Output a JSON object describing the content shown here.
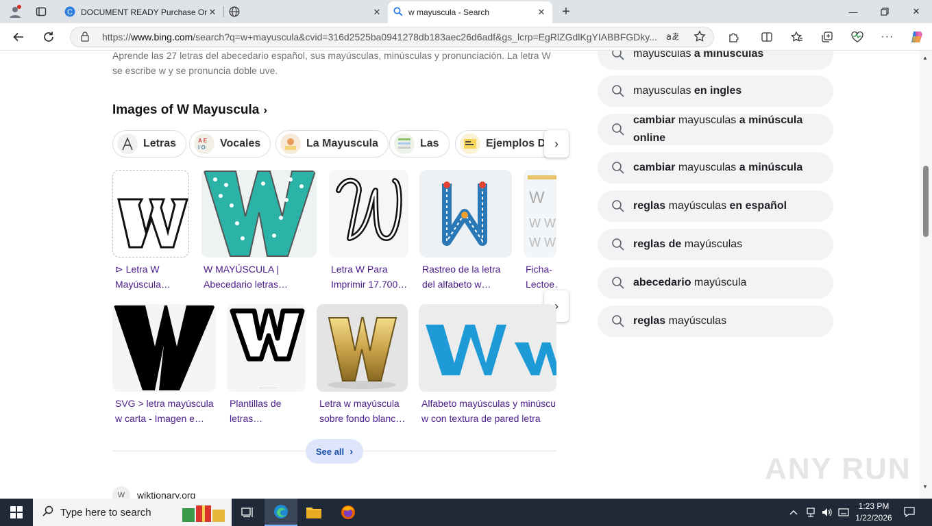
{
  "browser": {
    "tabs": [
      {
        "title": "DOCUMENT READY Purchase Order",
        "active": false
      },
      {
        "title": "",
        "active": false
      },
      {
        "title": "w mayuscula - Search",
        "active": true
      }
    ],
    "new_tab_symbol": "+",
    "url_prefix": "https://",
    "url_host": "www.bing.com",
    "url_rest": "/search?q=w+mayuscula&cvid=316d2525ba0941278db183aec26d6adf&gs_lcrp=EgRlZGdlKgYIABBFGDky..."
  },
  "page": {
    "snippet": "Aprende las 27 letras del abecedario español, sus mayúsculas, minúsculas y pronunciación. La letra W se escribe w y se pronuncia doble uve.",
    "images_heading": "Images of W Mayuscula",
    "chips": [
      "Letras",
      "Vocales",
      "La Mayuscula",
      "Las",
      "Ejemplos De"
    ],
    "row1_captions": [
      "⊳ Letra W Mayúscula…",
      "W MAYÚSCULA | Abecedario letras…",
      "Letra W Para Imprimir 17.700…",
      "Rastreo de la letra del alfabeto w…",
      "Ficha-Lectoe…"
    ],
    "row2_captions": [
      "SVG > letra mayúscula w carta - Imagen e…",
      "Plantillas de letras…",
      "Letra w mayúscula sobre fondo blanc…",
      "Alfabeto mayúsculas y minúscu w con textura de pared letra azu"
    ],
    "see_all": "See all",
    "next_result_site": "wiktionary.org"
  },
  "related_searches": [
    {
      "plain1": "mayusculas ",
      "bold": "a minusculas",
      "plain2": ""
    },
    {
      "plain1": "mayusculas ",
      "bold": "en ingles",
      "plain2": ""
    },
    {
      "bold_pre": "cambiar",
      "plain1": " mayusculas ",
      "bold": "a minúscula online",
      "plain2": ""
    },
    {
      "bold_pre": "cambiar",
      "plain1": " mayusculas ",
      "bold": "a minúscula",
      "plain2": ""
    },
    {
      "bold_pre": "reglas",
      "plain1": " mayúsculas ",
      "bold": "en español",
      "plain2": ""
    },
    {
      "bold_pre": "reglas de",
      "plain1": " mayúsculas",
      "bold": "",
      "plain2": ""
    },
    {
      "bold_pre": "abecedario",
      "plain1": " mayúscula",
      "bold": "",
      "plain2": ""
    },
    {
      "bold_pre": "reglas",
      "plain1": " mayúsculas",
      "bold": "",
      "plain2": ""
    }
  ],
  "watermark": "ANY RUN",
  "taskbar": {
    "search_placeholder": "Type here to search",
    "time": "1:23 PM",
    "date": "1/22/2026"
  },
  "colors": {
    "caption_link": "#4b1c8a",
    "see_all_bg": "#dfe6fb",
    "taskbar_bg": "#1f2937",
    "tile_teal": "#2bb3a8",
    "tile_blue": "#1e9ad6",
    "tile_gold": "#c9a24a"
  },
  "icons": {
    "profile": "profile-icon",
    "tab_actions": "tab-actions-icon",
    "back": "back-arrow-icon",
    "refresh": "refresh-icon",
    "lock": "lock-icon",
    "read_aloud": "read-aloud-icon",
    "favorite": "star-icon",
    "extensions": "puzzle-icon",
    "split": "split-screen-icon",
    "favorites": "favorites-icon",
    "collections": "collections-icon",
    "performance": "heart-pulse-icon",
    "more": "more-icon",
    "copilot": "copilot-icon"
  }
}
